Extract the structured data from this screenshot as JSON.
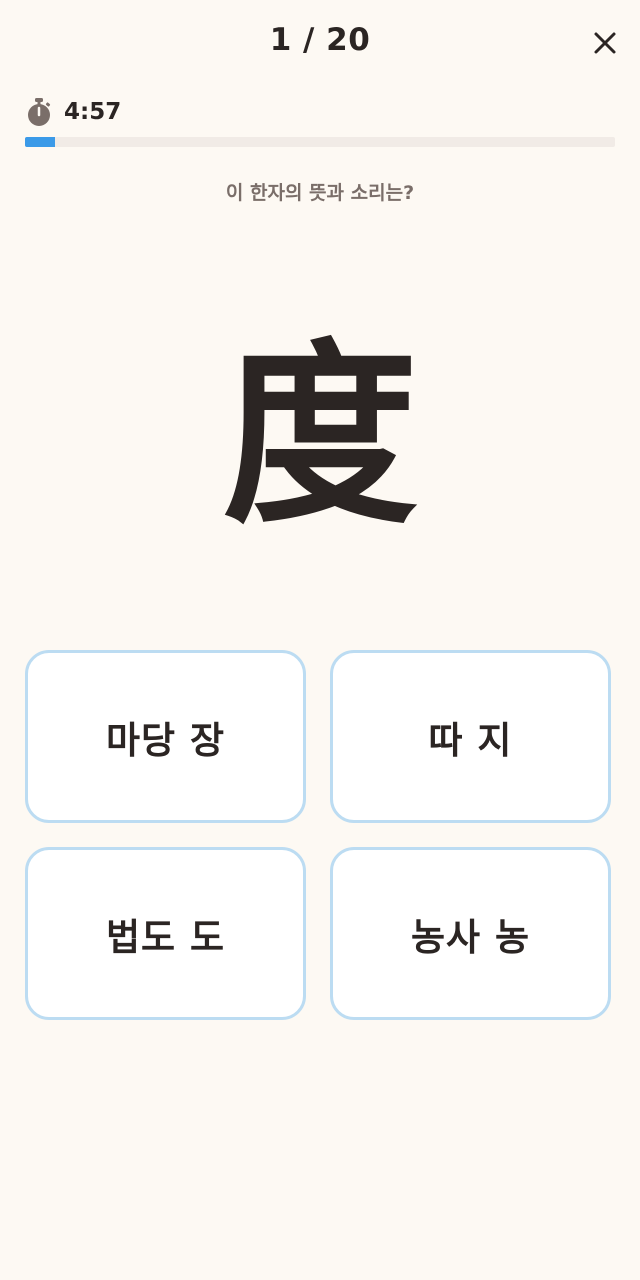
{
  "header": {
    "progress": "1 / 20",
    "close_icon": "close-icon"
  },
  "timer": {
    "icon": "stopwatch-icon",
    "value": "4:57"
  },
  "progress_bar": {
    "fraction": 0.05,
    "fill_color": "#3b9ae8",
    "track_color": "#f1ebe6"
  },
  "question": {
    "prompt": "이 한자의 뜻과 소리는?",
    "character": "度"
  },
  "answers": [
    {
      "label": "마당 장"
    },
    {
      "label": "따 지"
    },
    {
      "label": "법도 도"
    },
    {
      "label": "농사 농"
    }
  ],
  "colors": {
    "background": "#fdf9f3",
    "text": "#2b2523",
    "answer_border": "#bcdcf2"
  }
}
